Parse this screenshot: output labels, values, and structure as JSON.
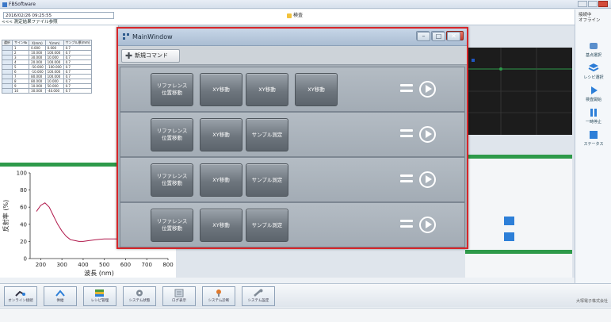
{
  "app": {
    "title": "FBSoftware",
    "timestamp": "2016/02/26 09:25:55",
    "center_tab": "検査",
    "breadcrumb": "<<< 測定結果ファイル参照",
    "status_label_line1": "接続中",
    "status_label_line2": "オフライン"
  },
  "left_table": {
    "headers": [
      "選択",
      "サイン№",
      "X(mm)",
      "Y(mm)",
      "サンプル厚(mm)"
    ],
    "rows": [
      [
        "",
        "1",
        "0.000",
        "0.000",
        "0.7"
      ],
      [
        "",
        "2",
        "10.000",
        "100.000",
        "0.7"
      ],
      [
        "",
        "3",
        "30.000",
        "10.000",
        "0.7"
      ],
      [
        "",
        "4",
        "20.000",
        "100.000",
        "0.7"
      ],
      [
        "",
        "5",
        "-50.000",
        "-100.000",
        "0.7"
      ],
      [
        "",
        "6",
        "-10.000",
        "100.000",
        "0.7"
      ],
      [
        "",
        "7",
        "80.000",
        "100.000",
        "0.7"
      ],
      [
        "",
        "8",
        "80.000",
        "10.000",
        "0.7"
      ],
      [
        "",
        "9",
        "10.000",
        "50.000",
        "0.7"
      ],
      [
        "",
        "10",
        "30.000",
        "-40.000",
        "0.7"
      ]
    ]
  },
  "chart_data": {
    "type": "line",
    "title": "",
    "xlabel": "波長 (nm)",
    "ylabel": "反射率 (%)",
    "xlim": [
      150,
      800
    ],
    "ylim": [
      0,
      100
    ],
    "xticks": [
      200,
      300,
      400,
      500,
      600,
      700,
      800
    ],
    "yticks": [
      0,
      20,
      40,
      60,
      80,
      100
    ],
    "series": [
      {
        "x": [
          180,
          200,
          220,
          240,
          260,
          280,
          300,
          320,
          340,
          360,
          380,
          400,
          430,
          460,
          500,
          550,
          600,
          700,
          800
        ],
        "y": [
          55,
          62,
          65,
          60,
          50,
          40,
          32,
          26,
          22,
          21,
          20,
          20,
          21,
          22,
          23,
          23,
          23,
          23,
          23
        ]
      }
    ]
  },
  "main_window": {
    "title": "MainWindow",
    "new_command_label": "新規コマンド",
    "rows": [
      {
        "buttons": [
          "リファレンス\n位置移動",
          "XY移動",
          "XY移動",
          "XY移動"
        ]
      },
      {
        "buttons": [
          "リファレンス\n位置移動",
          "XY移動",
          "サンプル測定"
        ]
      },
      {
        "buttons": [
          "リファレンス\n位置移動",
          "XY移動",
          "サンプル測定"
        ]
      },
      {
        "buttons": [
          "リファレンス\n位置移動",
          "XY移動",
          "サンプル測定"
        ]
      }
    ]
  },
  "right_panel": {
    "buttons": [
      "基点選択",
      "レシピ選択",
      "検査開始",
      "一時停止",
      "ステータス"
    ]
  },
  "bottom_toolbar": {
    "buttons": [
      "オンライン接続",
      "供給",
      "レシピ管理",
      "システム状態",
      "ログ表示",
      "システム診断",
      "システム設定"
    ],
    "company": "大塚電子株式会社"
  },
  "colors": {
    "highlight_border": "#d7262a",
    "command_button": "#6e767e",
    "status_green": "#2e9a4a"
  }
}
